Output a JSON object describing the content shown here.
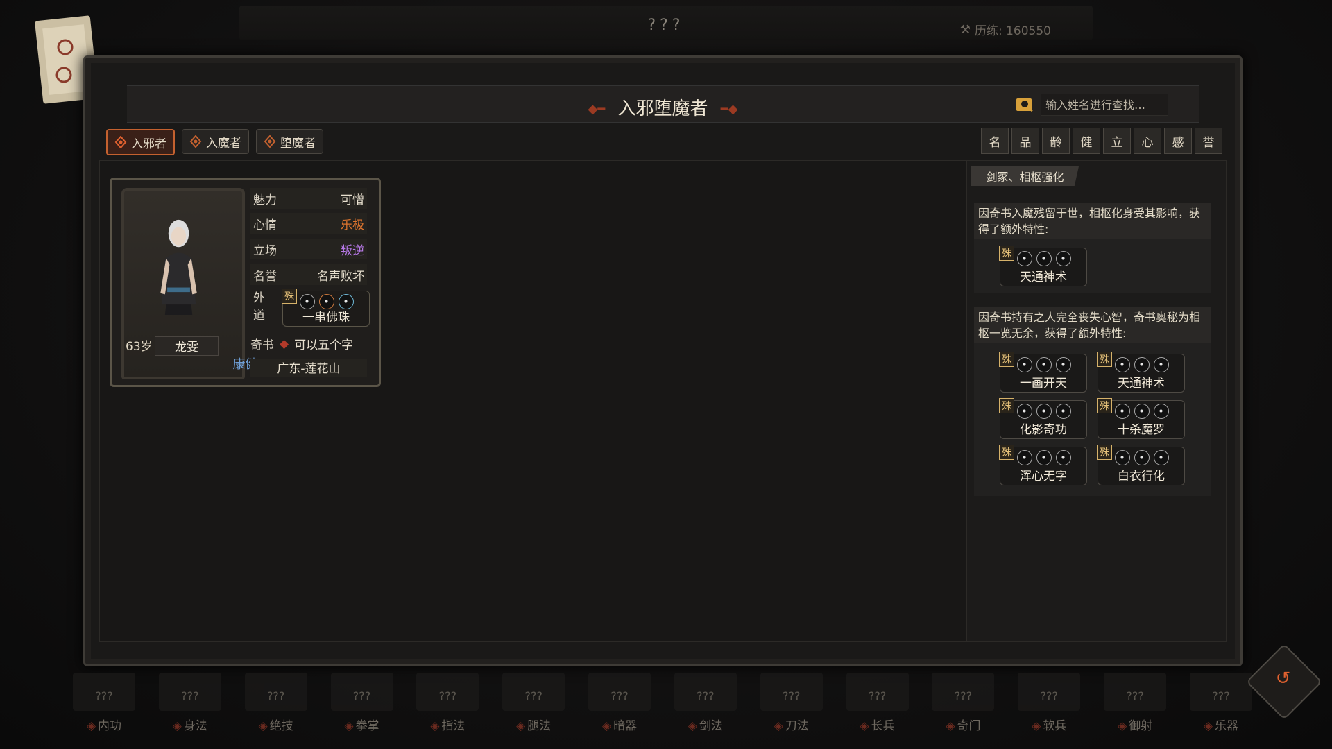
{
  "top_bar": {
    "title": "???",
    "exp_label": "历练: 160550"
  },
  "panel": {
    "title": "入邪堕魔者",
    "search_placeholder": "输入姓名进行查找…",
    "tabs": [
      {
        "label": "入邪者",
        "active": true
      },
      {
        "label": "入魔者",
        "active": false
      },
      {
        "label": "堕魔者",
        "active": false
      }
    ],
    "sort_buttons": [
      "名",
      "品",
      "龄",
      "健",
      "立",
      "心",
      "感",
      "誉"
    ]
  },
  "character": {
    "age": "63岁",
    "name": "龙雯",
    "health": "康健",
    "attributes": [
      {
        "label": "魅力",
        "value": "可憎",
        "color": "#e8e0cf"
      },
      {
        "label": "心情",
        "value": "乐极",
        "color": "#e0752e"
      },
      {
        "label": "立场",
        "value": "叛逆",
        "color": "#b678e6"
      },
      {
        "label": "名誉",
        "value": "名声败坏",
        "color": "#e8e0cf"
      }
    ],
    "waidao_label": "外道",
    "waidao_badge": "殊",
    "waidao_item": "一串佛珠",
    "qishu_label": "奇书",
    "qishu_value": "可以五个字",
    "location": "广东-莲花山"
  },
  "right_panel": {
    "header": "剑冢、相枢强化",
    "desc1": "因奇书入魔残留于世，相枢化身受其影响，获得了额外特性:",
    "traits1": [
      {
        "badge": "殊",
        "name": "天通神术"
      }
    ],
    "desc2": "因奇书持有之人完全丧失心智，奇书奥秘为相枢一览无余，获得了额外特性:",
    "traits2": [
      {
        "badge": "殊",
        "name": "一画开天"
      },
      {
        "badge": "殊",
        "name": "天通神术"
      },
      {
        "badge": "殊",
        "name": "化影奇功"
      },
      {
        "badge": "殊",
        "name": "十杀魔罗"
      },
      {
        "badge": "殊",
        "name": "浑心无字"
      },
      {
        "badge": "殊",
        "name": "白衣行化"
      }
    ]
  },
  "bottom_slots": [
    {
      "top": "???",
      "label": "内功"
    },
    {
      "top": "???",
      "label": "身法"
    },
    {
      "top": "???",
      "label": "绝技"
    },
    {
      "top": "???",
      "label": "拳掌"
    },
    {
      "top": "???",
      "label": "指法"
    },
    {
      "top": "???",
      "label": "腿法"
    },
    {
      "top": "???",
      "label": "暗器"
    },
    {
      "top": "???",
      "label": "剑法"
    },
    {
      "top": "???",
      "label": "刀法"
    },
    {
      "top": "???",
      "label": "长兵"
    },
    {
      "top": "???",
      "label": "奇门"
    },
    {
      "top": "???",
      "label": "软兵"
    },
    {
      "top": "???",
      "label": "御射"
    },
    {
      "top": "???",
      "label": "乐器"
    }
  ]
}
